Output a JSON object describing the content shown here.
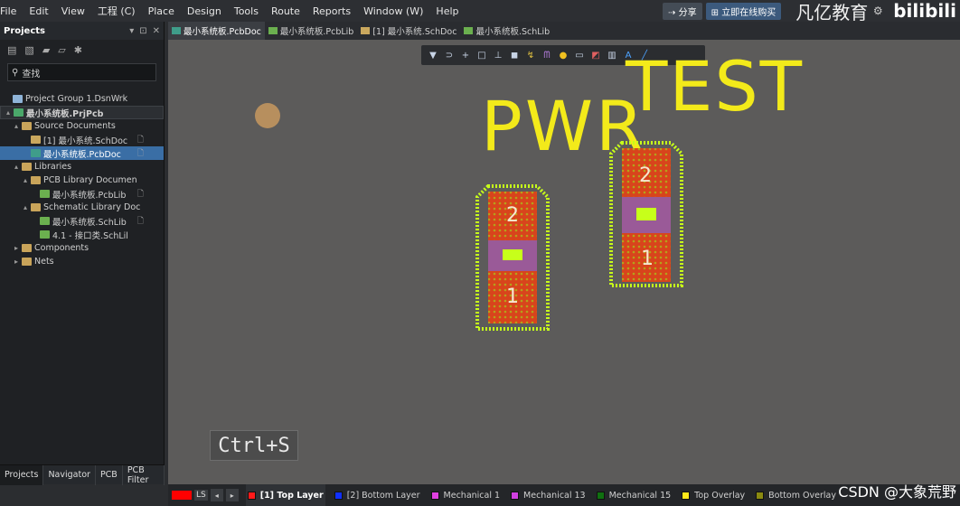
{
  "menubar": {
    "items": [
      "File",
      "Edit",
      "View",
      "工程 (C)",
      "Place",
      "Design",
      "Tools",
      "Route",
      "Reports",
      "Window (W)",
      "Help"
    ],
    "share_label": "分享",
    "buy_label": "立即在线购买",
    "brand": "凡亿教育",
    "bili": "bilibili"
  },
  "projects_panel": {
    "title": "Projects",
    "search_placeholder": "查找",
    "tree": [
      {
        "label": "Project Group 1.DsnWrk",
        "level": 0,
        "icon": "workspace",
        "arrow": ""
      },
      {
        "label": "最小系统板.PrjPcb",
        "level": 0,
        "icon": "project",
        "arrow": "▴",
        "bold": true,
        "highlight": true
      },
      {
        "label": "Source Documents",
        "level": 1,
        "icon": "folder",
        "arrow": "▴"
      },
      {
        "label": "[1] 最小系统.SchDoc",
        "level": 2,
        "icon": "sch",
        "arrow": "",
        "doc": true
      },
      {
        "label": "最小系统板.PcbDoc",
        "level": 2,
        "icon": "pcb",
        "arrow": "",
        "doc": true,
        "selected": true
      },
      {
        "label": "Libraries",
        "level": 1,
        "icon": "folder",
        "arrow": "▴"
      },
      {
        "label": "PCB Library Documen",
        "level": 2,
        "icon": "folder",
        "arrow": "▴"
      },
      {
        "label": "最小系统板.PcbLib",
        "level": 3,
        "icon": "lib",
        "arrow": "",
        "doc": true
      },
      {
        "label": "Schematic Library Doc",
        "level": 2,
        "icon": "folder",
        "arrow": "▴"
      },
      {
        "label": "最小系统板.SchLib",
        "level": 3,
        "icon": "lib",
        "arrow": "",
        "doc": true
      },
      {
        "label": "4.1   - 接口类.SchLil",
        "level": 3,
        "icon": "lib",
        "arrow": ""
      },
      {
        "label": "Components",
        "level": 1,
        "icon": "folder",
        "arrow": "▸"
      },
      {
        "label": "Nets",
        "level": 1,
        "icon": "folder",
        "arrow": "▸"
      }
    ],
    "bottom_tabs": [
      "Projects",
      "Navigator",
      "PCB",
      "PCB Filter"
    ]
  },
  "doc_tabs": [
    {
      "label": "最小系统板.PcbDoc",
      "active": true,
      "icon": "pcb"
    },
    {
      "label": "最小系统板.PcbLib",
      "active": false,
      "icon": "lib"
    },
    {
      "label": "[1] 最小系统.SchDoc",
      "active": false,
      "icon": "sch"
    },
    {
      "label": "最小系统板.SchLib",
      "active": false,
      "icon": "lib"
    }
  ],
  "canvas": {
    "silk_pwr": "PWR",
    "silk_test": "TEST",
    "pad_labels": {
      "left_top": "2",
      "left_bottom": "1",
      "right_top": "2",
      "right_bottom": "1"
    },
    "shortcut": "Ctrl+S"
  },
  "toolbar_icons": [
    "filter-icon",
    "route-icon",
    "crosshair-icon",
    "rect-select-icon",
    "align-icon",
    "component-icon",
    "interactive-route-icon",
    "diff-pair-icon",
    "via-icon",
    "fill-icon",
    "polygon-icon",
    "chart-icon",
    "text-icon",
    "line-icon"
  ],
  "status": {
    "ls_label": "LS",
    "layers": [
      {
        "label": "[1] Top Layer",
        "color": "#ff1a1a",
        "active": true
      },
      {
        "label": "[2] Bottom Layer",
        "color": "#1030ff",
        "active": false
      },
      {
        "label": "Mechanical 1",
        "color": "#e040e0",
        "active": false
      },
      {
        "label": "Mechanical 13",
        "color": "#d040e0",
        "active": false
      },
      {
        "label": "Mechanical 15",
        "color": "#107010",
        "active": false
      },
      {
        "label": "Top Overlay",
        "color": "#ffe81a",
        "active": false
      },
      {
        "label": "Bottom Overlay",
        "color": "#8a8a10",
        "active": false
      }
    ],
    "watermark": "CSDN @大象荒野"
  },
  "colors": {
    "silk": "#f3ea1a",
    "pad": "#d8441c",
    "board": "#5c5b5a",
    "solder": "#9a5a98",
    "outline": "#c7ff1a"
  }
}
